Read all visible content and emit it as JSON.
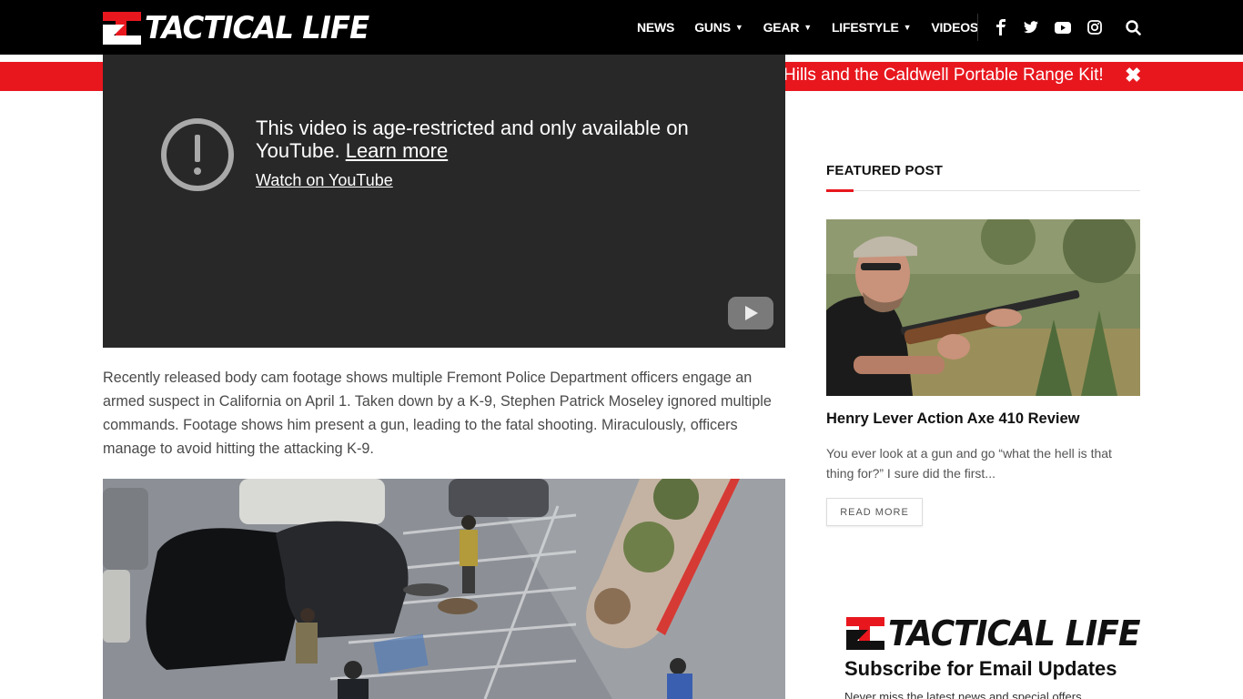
{
  "header": {
    "logo_text": "TACTICAL LIFE",
    "nav": [
      {
        "label": "NEWS",
        "has_dropdown": false
      },
      {
        "label": "GUNS",
        "has_dropdown": true
      },
      {
        "label": "GEAR",
        "has_dropdown": true
      },
      {
        "label": "LIFESTYLE",
        "has_dropdown": true
      },
      {
        "label": "VIDEOS",
        "has_dropdown": false
      }
    ],
    "social_icons": [
      "facebook-icon",
      "twitter-icon",
      "youtube-icon",
      "instagram-icon"
    ],
    "search_icon": "search-icon"
  },
  "banner": {
    "text": "Hills and the Caldwell Portable Range Kit!",
    "close_icon": "close-icon"
  },
  "video": {
    "message": "This video is age-restricted and only available on YouTube.",
    "learn_more": "Learn more",
    "watch_link": "Watch on YouTube"
  },
  "article": {
    "paragraph": "Recently released body cam footage shows multiple Fremont Police Department officers engage an armed suspect in California on April 1. Taken down by a K-9, Stephen Patrick Moseley ignored multiple commands. Footage shows him present a gun, leading to the fatal shooting. Miraculously, officers manage to avoid hitting the attacking K-9."
  },
  "sidebar": {
    "featured_heading": "FEATURED POST",
    "post_title": "Henry Lever Action Axe 410 Review",
    "post_excerpt": "You ever look at a gun and go “what the hell is that thing for?” I sure did the first...",
    "read_more": "READ MORE",
    "subscribe_logo_text": "TACTICAL LIFE",
    "subscribe_heading": "Subscribe for Email Updates",
    "subscribe_text": "Never miss the latest news and special offers"
  },
  "colors": {
    "brand_red": "#e8171e",
    "header_bg": "#000000",
    "video_bg": "#282828"
  }
}
